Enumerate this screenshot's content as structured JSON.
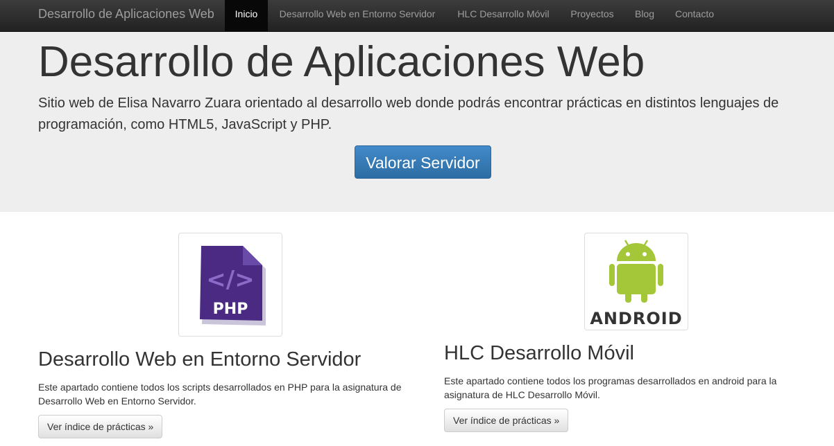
{
  "navbar": {
    "brand": "Desarrollo de Aplicaciones Web",
    "items": [
      {
        "label": "Inicio",
        "active": true
      },
      {
        "label": "Desarrollo Web en Entorno Servidor"
      },
      {
        "label": "HLC Desarrollo Móvil"
      },
      {
        "label": "Proyectos"
      },
      {
        "label": "Blog"
      },
      {
        "label": "Contacto"
      }
    ]
  },
  "hero": {
    "title": "Desarrollo de Aplicaciones Web",
    "description": "Sitio web de Elisa Navarro Zuara orientado al desarrollo web donde podrás encontrar prácticas en distintos lenguajes de programación, como HTML5, JavaScript y PHP.",
    "button_label": "Valorar Servidor",
    "button_color": "#428bca"
  },
  "cards": [
    {
      "logo_icon": "php-file-icon",
      "logo_text": "PHP",
      "title": "Desarrollo Web en Entorno Servidor",
      "description": "Este apartado contiene todos los scripts desarrollados en PHP para la asignatura de Desarrollo Web en Entorno Servidor.",
      "button_label": "Ver índice de prácticas »"
    },
    {
      "logo_icon": "android-icon",
      "logo_text": "ANDROID",
      "title": "HLC Desarrollo Móvil",
      "description": "Este apartado contiene todos los programas desarrollados en android para la asignatura de HLC Desarrollo Móvil.",
      "button_label": "Ver índice de prácticas »"
    }
  ],
  "colors": {
    "navbar_bg": "#222222",
    "jumbotron_bg": "#eeeeee",
    "php_purple": "#4a2a82",
    "android_green": "#a4c639"
  }
}
